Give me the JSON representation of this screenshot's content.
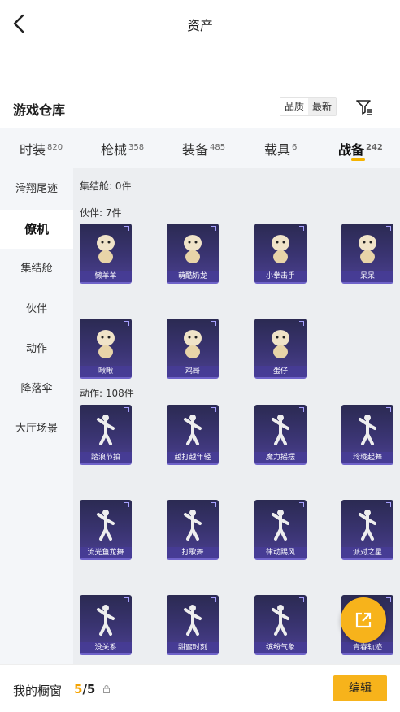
{
  "header": {
    "title": "资产"
  },
  "section": {
    "title": "游戏仓库",
    "sort_options": [
      "品质",
      "最新"
    ],
    "sort_selected": "最新"
  },
  "tabs": [
    {
      "label": "时装",
      "count": "820"
    },
    {
      "label": "枪械",
      "count": "358"
    },
    {
      "label": "装备",
      "count": "485"
    },
    {
      "label": "载具",
      "count": "6"
    },
    {
      "label": "战备",
      "count": "242",
      "active": true
    }
  ],
  "sidebar": {
    "items": [
      "滑翔尾迹",
      "僚机",
      "集结舱",
      "伙伴",
      "动作",
      "降落伞",
      "大厅场景"
    ],
    "active_index": 1
  },
  "content": {
    "groups": [
      {
        "label": "集结舱: 0件",
        "items": []
      },
      {
        "label": "伙伴: 7件",
        "items": [
          "懒羊羊",
          "萌酷奶龙",
          "小拳击手",
          "呆呆",
          "啾啾",
          "鸡哥",
          "蛋仔"
        ]
      },
      {
        "label": "动作: 108件",
        "items": [
          "踏浪节拍",
          "越打越年轻",
          "魔力摇摆",
          "玲珑起舞",
          "流光鱼龙舞",
          "打歌舞",
          "律动踢风",
          "派对之星",
          "没关系",
          "甜蜜时刻",
          "缤纷气象",
          "青春轨迹"
        ]
      }
    ]
  },
  "bottom": {
    "label": "我的橱窗",
    "current": "5",
    "total": "5",
    "edit_label": "编辑"
  },
  "colors": {
    "accent": "#f7b31b",
    "card_bg": "#3a3472"
  }
}
